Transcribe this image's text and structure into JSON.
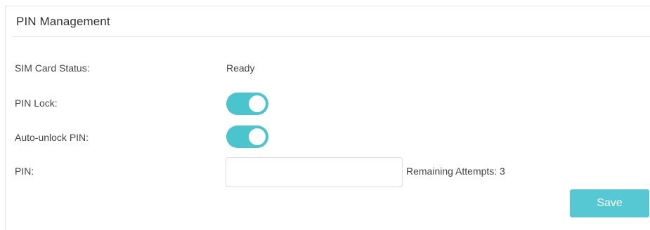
{
  "panel": {
    "title": "PIN Management"
  },
  "rows": {
    "sim_status": {
      "label": "SIM Card Status:",
      "value": "Ready"
    },
    "pin_lock": {
      "label": "PIN Lock:",
      "state": "on"
    },
    "auto_unlock": {
      "label": "Auto-unlock PIN:",
      "state": "on"
    },
    "pin": {
      "label": "PIN:",
      "value": "",
      "placeholder": "",
      "remaining": "Remaining Attempts: 3"
    }
  },
  "actions": {
    "save_label": "Save"
  },
  "colors": {
    "toggle_on": "#4ac5ce",
    "button": "#56c8d4"
  }
}
